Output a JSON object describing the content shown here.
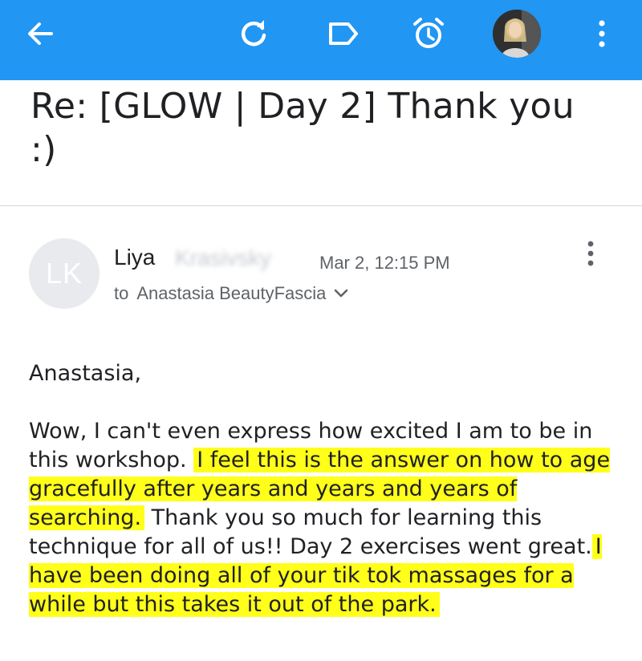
{
  "toolbar": {
    "back_icon": "arrow-back-icon",
    "refresh_icon": "refresh-icon",
    "label_icon": "label-icon",
    "snooze_icon": "alarm-clock-icon",
    "more_icon": "more-vertical-icon",
    "bar_color": "#2196f3"
  },
  "email": {
    "subject": "Re: [GLOW | Day 2] Thank you :)",
    "sender": {
      "initials": "LK",
      "first_name": "Liya",
      "last_name_blurred": "Krasivsky",
      "date": "Mar 2, 12:15 PM"
    },
    "recipient": {
      "to_label": "to",
      "name": "Anastasia BeautyFascia"
    },
    "body": {
      "greeting": "Anastasia,",
      "seg1": "Wow, I can't even express how excited I am to be in this workshop. ",
      "highlight1": "I feel this is the answer on how to age gracefully after years and years and years of searching.",
      "seg2": " Thank you so much for learning this technique for all of us!! Day 2 exercises went great.",
      "highlight2": "I have been doing all of your tik tok massages for a while but this takes it out of the park.",
      "highlight_color": "#ffff1a"
    }
  }
}
